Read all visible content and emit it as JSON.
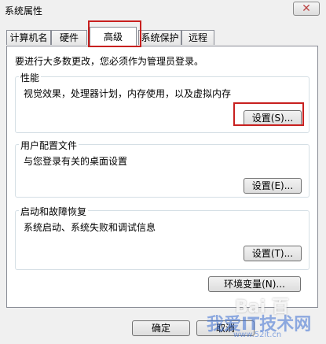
{
  "window": {
    "title": "系统属性",
    "close_glyph": "✕",
    "close_icon": "close-icon"
  },
  "tabs": [
    {
      "label": "计算机名"
    },
    {
      "label": "硬件"
    },
    {
      "label": "高级",
      "active": true
    },
    {
      "label": "系统保护"
    },
    {
      "label": "远程"
    }
  ],
  "main": {
    "admin_note": "要进行大多数更改，您必须作为管理员登录。",
    "performance": {
      "legend": "性能",
      "desc": "视觉效果，处理器计划，内存使用，以及虚拟内存",
      "button": "设置(S)..."
    },
    "user_profiles": {
      "legend": "用户配置文件",
      "desc": "与您登录有关的桌面设置",
      "button": "设置(E)..."
    },
    "startup_recovery": {
      "legend": "启动和故障恢复",
      "desc": "系统启动、系统失败和调试信息",
      "button": "设置(T)..."
    },
    "env_vars_button": "环境变量(N)..."
  },
  "footer": {
    "ok": "确定",
    "cancel": "取消"
  },
  "watermark": {
    "baidu": "Bai 百",
    "site": "我爱IT技术网",
    "url": "www.52it.cn"
  },
  "highlight_color": "#c8201f"
}
